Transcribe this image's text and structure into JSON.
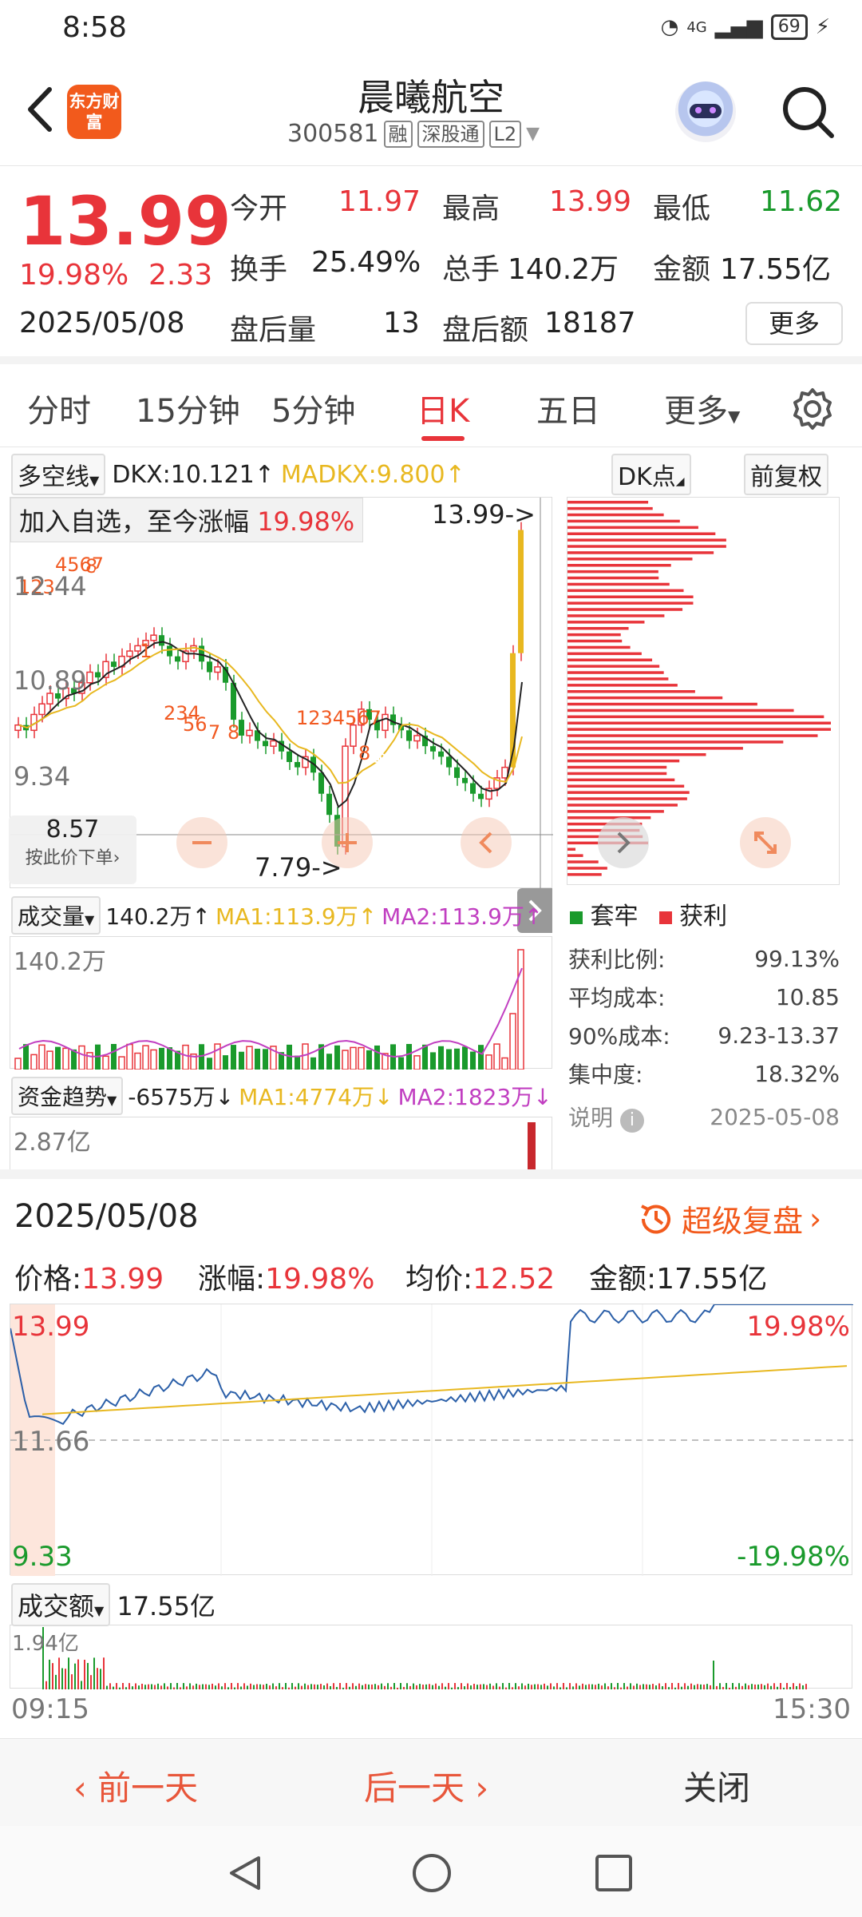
{
  "status": {
    "time": "8:58",
    "signal": "4G",
    "battery": "69"
  },
  "header": {
    "logo_text": "东方财富",
    "name": "晨曦航空",
    "code": "300581",
    "tags": [
      "融",
      "深股通",
      "L2"
    ]
  },
  "quote": {
    "price": "13.99",
    "change_pct": "19.98%",
    "change_amt": "2.33",
    "date": "2025/05/08",
    "open_label": "今开",
    "open": "11.97",
    "high_label": "最高",
    "high": "13.99",
    "low_label": "最低",
    "low": "11.62",
    "turnover_label": "换手",
    "turnover": "25.49%",
    "volume_label": "总手",
    "volume": "140.2万",
    "amount_label": "金额",
    "amount": "17.55亿",
    "ah_vol_label": "盘后量",
    "ah_vol": "13",
    "ah_amt_label": "盘后额",
    "ah_amt": "18187",
    "more_label": "更多"
  },
  "tabs": [
    "分时",
    "15分钟",
    "5分钟",
    "日K",
    "五日",
    "更多"
  ],
  "indicator": {
    "name": "多空线",
    "dkx": "DKX:10.121",
    "madkx": "MADKX:9.800",
    "dk_points": "DK点",
    "adjust": "前复权"
  },
  "kchart": {
    "watch_note": "加入自选，至今涨幅",
    "watch_pct": "19.98%",
    "high_mark": "13.99->",
    "low_mark": "7.79->",
    "y_labels": [
      "12.44",
      "10.89",
      "9.34"
    ],
    "cursor_price": "8.57",
    "cursor_hint": "按此价下单",
    "seq_markers": [
      "123",
      "4567",
      "8",
      "9",
      "1",
      "234",
      "56",
      "7",
      "8",
      "9",
      "1234567",
      "8",
      "9"
    ],
    "closes": [
      10.3,
      10.2,
      10.5,
      10.7,
      10.9,
      10.8,
      11.0,
      10.9,
      11.1,
      11.3,
      11.2,
      11.5,
      11.4,
      11.6,
      11.7,
      11.8,
      11.9,
      12.0,
      11.8,
      11.6,
      11.5,
      11.7,
      11.8,
      11.5,
      11.3,
      11.4,
      11.1,
      10.4,
      10.1,
      10.2,
      10.0,
      9.9,
      10.0,
      9.8,
      9.6,
      9.5,
      9.7,
      9.4,
      9.0,
      8.6,
      8.0,
      9.9,
      10.3,
      10.6,
      10.4,
      10.2,
      10.5,
      10.3,
      10.2,
      10.0,
      10.1,
      9.9,
      9.8,
      9.7,
      9.5,
      9.3,
      9.2,
      9.0,
      8.9,
      9.1,
      9.3,
      9.5,
      11.66,
      13.99
    ]
  },
  "profile": {
    "legend_trapped": "套牢",
    "legend_profit": "获利",
    "rows": [
      {
        "label": "获利比例:",
        "value": "99.13%"
      },
      {
        "label": "平均成本:",
        "value": "10.85"
      },
      {
        "label": "90%成本:",
        "value": "9.23-13.37"
      },
      {
        "label": "集中度:",
        "value": "18.32%"
      }
    ],
    "note": "说明",
    "date": "2025-05-08"
  },
  "volume": {
    "name": "成交量",
    "value": "140.2万",
    "ma1": "MA1:113.9万",
    "ma2": "MA2:113.9万",
    "max_label": "140.2万"
  },
  "fund": {
    "name": "资金趋势",
    "value": "-6575万",
    "ma1": "MA1:4774万",
    "ma2": "MA2:1823万",
    "max_label": "2.87亿"
  },
  "review": {
    "date": "2025/05/08",
    "super_replay": "超级复盘",
    "price_label": "价格:",
    "price": "13.99",
    "chg_label": "涨幅:",
    "chg": "19.98%",
    "avg_label": "均价:",
    "avg": "12.52",
    "amt_label": "金额:",
    "amt": "17.55亿",
    "y_top": "13.99",
    "y_mid": "11.66",
    "y_bot": "9.33",
    "pct_top": "19.98%",
    "pct_bot": "-19.98%",
    "amount_name": "成交额",
    "amount_value": "17.55亿",
    "amount_max": "1.94亿",
    "t_start": "09:15",
    "t_end": "15:30"
  },
  "bottom": {
    "prev": "前一天",
    "next": "后一天",
    "close": "关闭"
  },
  "colors": {
    "up": "#e8343a",
    "down": "#1a9a2c",
    "accent": "#f25a1c",
    "line_blue": "#2b5fa8",
    "line_yellow": "#e8b820"
  }
}
